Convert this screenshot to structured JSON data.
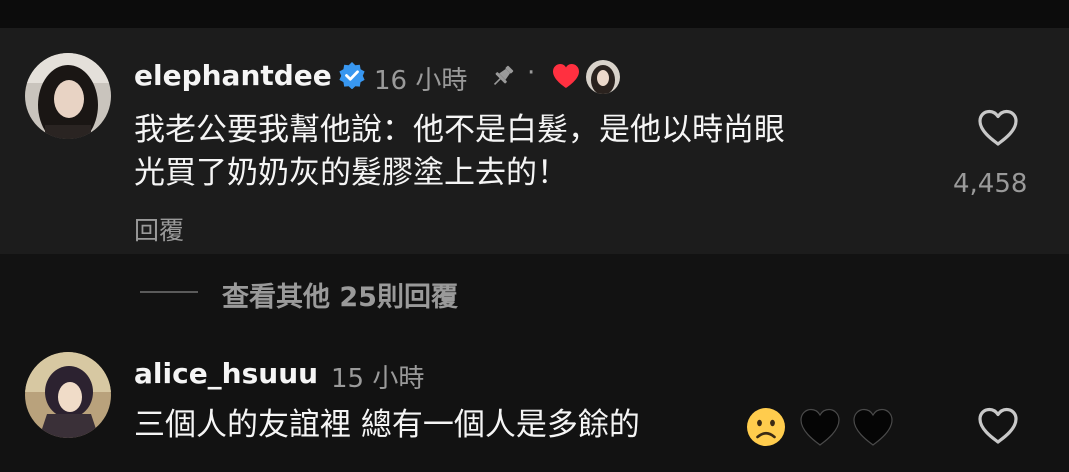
{
  "comments": [
    {
      "username": "elephantdee",
      "verified": true,
      "time": "16 小時",
      "pinned": true,
      "creator_liked": true,
      "body_lines": [
        "我老公要我幫他說：他不是白髮，是他以時尚眼",
        "光買了奶奶灰的髮膠塗上去的！"
      ],
      "reply_label": "回覆",
      "like_count": "4,458",
      "separator": "·"
    },
    {
      "username": "alice_hsuuu",
      "time": "15 小時",
      "body_text": "三個人的友誼裡 總有一個人是多餘的",
      "emojis": [
        "sad-face",
        "black-heart",
        "black-heart"
      ]
    }
  ],
  "view_more_replies": "查看其他 25則回覆",
  "colors": {
    "background": "#121212",
    "pinned_background": "#1c1c1c",
    "text": "#f5f5f5",
    "secondary_text": "#9a9a9a",
    "verified_blue": "#3897f0",
    "heart_red": "#ff3040"
  }
}
